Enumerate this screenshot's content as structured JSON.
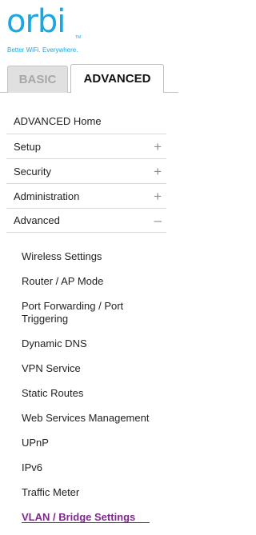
{
  "logo": {
    "word": "orbi",
    "tm": "TM",
    "tagline": "Better WiFi. Everywhere."
  },
  "tabs": {
    "basic": "BASIC",
    "advanced": "ADVANCED"
  },
  "menu": [
    {
      "label": "ADVANCED Home",
      "sign": ""
    },
    {
      "label": "Setup",
      "sign": "+"
    },
    {
      "label": "Security",
      "sign": "+"
    },
    {
      "label": "Administration",
      "sign": "+"
    },
    {
      "label": "Advanced",
      "sign": "–"
    }
  ],
  "submenu": [
    {
      "label": "Wireless Settings"
    },
    {
      "label": "Router / AP Mode"
    },
    {
      "label": "Port Forwarding / Port Triggering"
    },
    {
      "label": "Dynamic DNS"
    },
    {
      "label": "VPN Service"
    },
    {
      "label": "Static Routes"
    },
    {
      "label": "Web Services Management"
    },
    {
      "label": "UPnP"
    },
    {
      "label": "IPv6"
    },
    {
      "label": "Traffic Meter"
    },
    {
      "label": "VLAN / Bridge Settings"
    }
  ],
  "colors": {
    "brand": "#1aa7e0",
    "active": "#7d2a8c"
  }
}
